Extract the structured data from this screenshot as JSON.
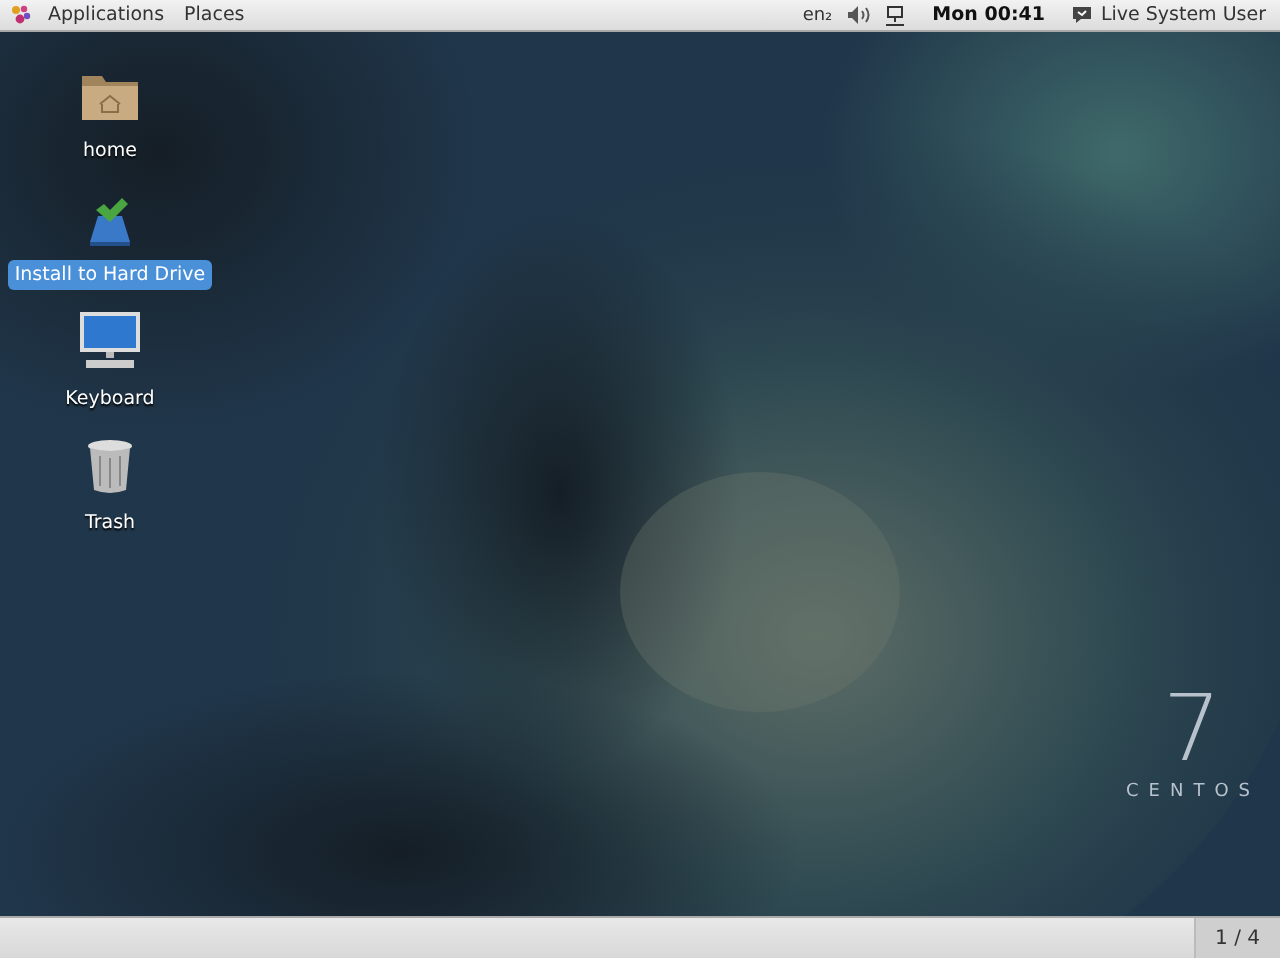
{
  "top_bar": {
    "menus": [
      {
        "label": "Applications"
      },
      {
        "label": "Places"
      }
    ],
    "keyboard_layout": "en₂",
    "clock": "Mon 00:41",
    "user": "Live System User"
  },
  "desktop": {
    "icons": [
      {
        "kind": "folder",
        "label": "home",
        "selected": false
      },
      {
        "kind": "installer",
        "label": "Install to Hard Drive",
        "selected": true
      },
      {
        "kind": "computer",
        "label": "Keyboard",
        "selected": false
      },
      {
        "kind": "trash",
        "label": "Trash",
        "selected": false
      }
    ],
    "wallpaper": {
      "kind": "picture",
      "logo_number": "7",
      "logo_name": "CENTOS"
    }
  },
  "bottom_bar": {
    "workspace": "1 / 4"
  }
}
